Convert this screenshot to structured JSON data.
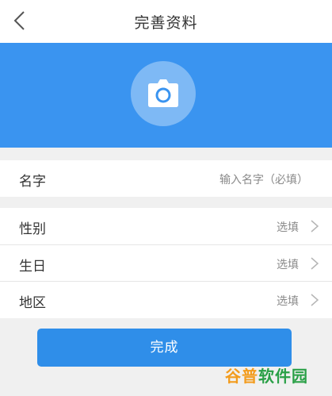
{
  "header": {
    "title": "完善资料",
    "back_icon": "chevron-left-icon"
  },
  "hero": {
    "background": "#3a94f0",
    "avatar_icon": "camera-icon"
  },
  "fields": {
    "name": {
      "label": "名字",
      "placeholder": "输入名字（必填）"
    },
    "gender": {
      "label": "性别",
      "value": "选填",
      "icon": "chevron-right-icon"
    },
    "birthday": {
      "label": "生日",
      "value": "选填",
      "icon": "chevron-right-icon"
    },
    "region": {
      "label": "地区",
      "value": "选填",
      "icon": "chevron-right-icon"
    }
  },
  "actions": {
    "done_label": "完成",
    "done_color": "#2f8ee9"
  },
  "watermark": {
    "part1": "谷普",
    "part2": "软件园"
  }
}
